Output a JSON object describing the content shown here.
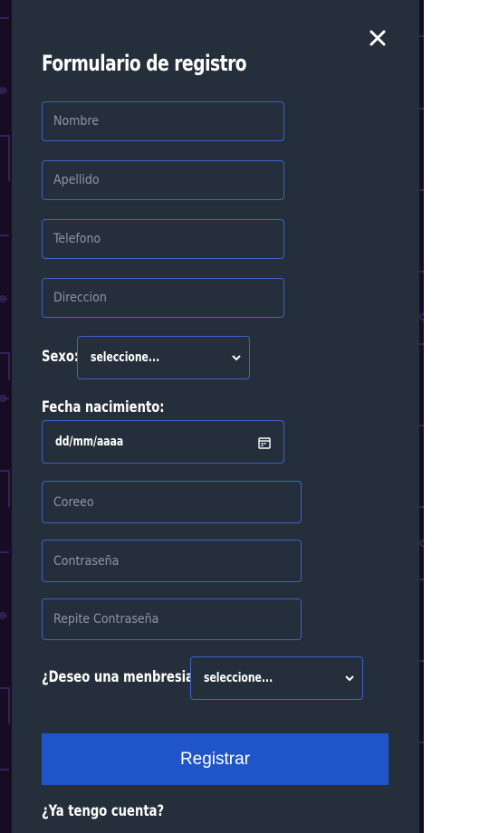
{
  "form": {
    "title": "Formulario de registro",
    "nombre_placeholder": "Nombre",
    "apellido_placeholder": "Apellido",
    "telefono_placeholder": "Telefono",
    "direccion_placeholder": "Direccion",
    "sexo_label": "Sexo:",
    "sexo_selected": "seleccione...",
    "fecha_label": "Fecha nacimiento:",
    "fecha_value": "dd/mm/aaaa",
    "correo_placeholder": "Coreeo",
    "contrasena_placeholder": "Contraseña",
    "repite_placeholder": "Repite Contraseña",
    "membresia_label": "¿Deseo una menbresia?:",
    "membresia_selected": "seleccione...",
    "submit_label": "Registrar",
    "login_link": "¿Ya tengo cuenta?"
  },
  "icons": {
    "close": "close-icon",
    "chevron": "chevron-down-icon",
    "calendar": "calendar-icon"
  },
  "colors": {
    "panel": "#252f3b",
    "border": "#3d63c9",
    "button": "#2055c9",
    "backdrop": "#160d24"
  }
}
